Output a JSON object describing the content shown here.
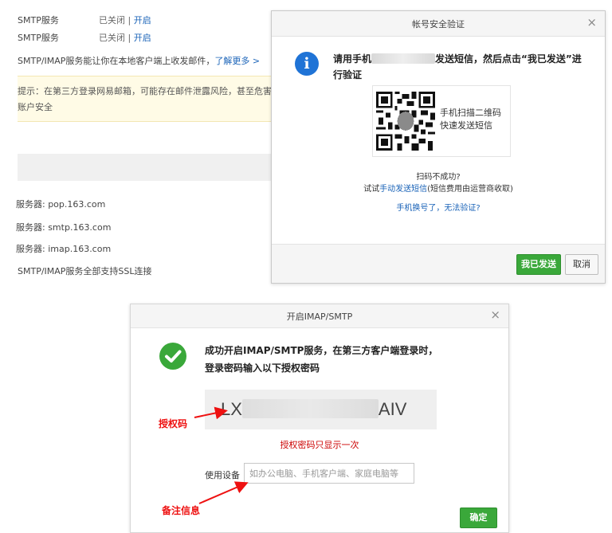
{
  "background": {
    "rows": [
      {
        "label": "SMTP服务",
        "status": "已关闭 | ",
        "action": "开启"
      },
      {
        "label": "SMTP服务",
        "status": "已关闭 | ",
        "action": "开启"
      }
    ],
    "intro_text": "SMTP/IMAP服务能让你在本地客户端上收发邮件，",
    "intro_link": "了解更多 >",
    "hint_line1": "提示：在第三方登录网易邮箱，可能存在邮件泄露风险，甚至危害Apple或",
    "hint_line2": "账户安全",
    "servers": [
      "服务器: pop.163.com",
      "服务器: smtp.163.com",
      "服务器: imap.163.com"
    ],
    "ssl_note": "SMTP/IMAP服务全部支持SSL连接"
  },
  "verify_dialog": {
    "title": "帐号安全验证",
    "close": "×",
    "info_icon": "i",
    "message_prefix": "请用手机",
    "message_suffix": "发送短信，然后点击“我已发送”进行验证",
    "qr_line1": "手机扫描二维码",
    "qr_line2": "快速发送短信",
    "scan_fail": "扫码不成功?",
    "try_prefix": "试试",
    "manual_link": "手动发送短信",
    "try_suffix": "(短信费用由运营商收取)",
    "phone_changed_link": "手机换号了，无法验证?",
    "confirm_button": "我已发送",
    "cancel_button": "取消"
  },
  "imap_dialog": {
    "title": "开启IMAP/SMTP",
    "close": "×",
    "message": "成功开启IMAP/SMTP服务，在第三方客户端登录时，登录密码输入以下授权密码",
    "code_prefix": "LX",
    "code_suffix": "AIV",
    "once_note": "授权密码只显示一次",
    "device_label": "使用设备",
    "device_placeholder": "如办公电脑、手机客户端、家庭电脑等",
    "device_value": "",
    "ok_button": "确定"
  },
  "annotations": {
    "auth_code": "授权码",
    "note_info": "备注信息"
  },
  "colors": {
    "green": "#3aa83a",
    "link_blue": "#1a63b8",
    "info_blue": "#1f73d6",
    "annotation_red": "#e11111"
  }
}
